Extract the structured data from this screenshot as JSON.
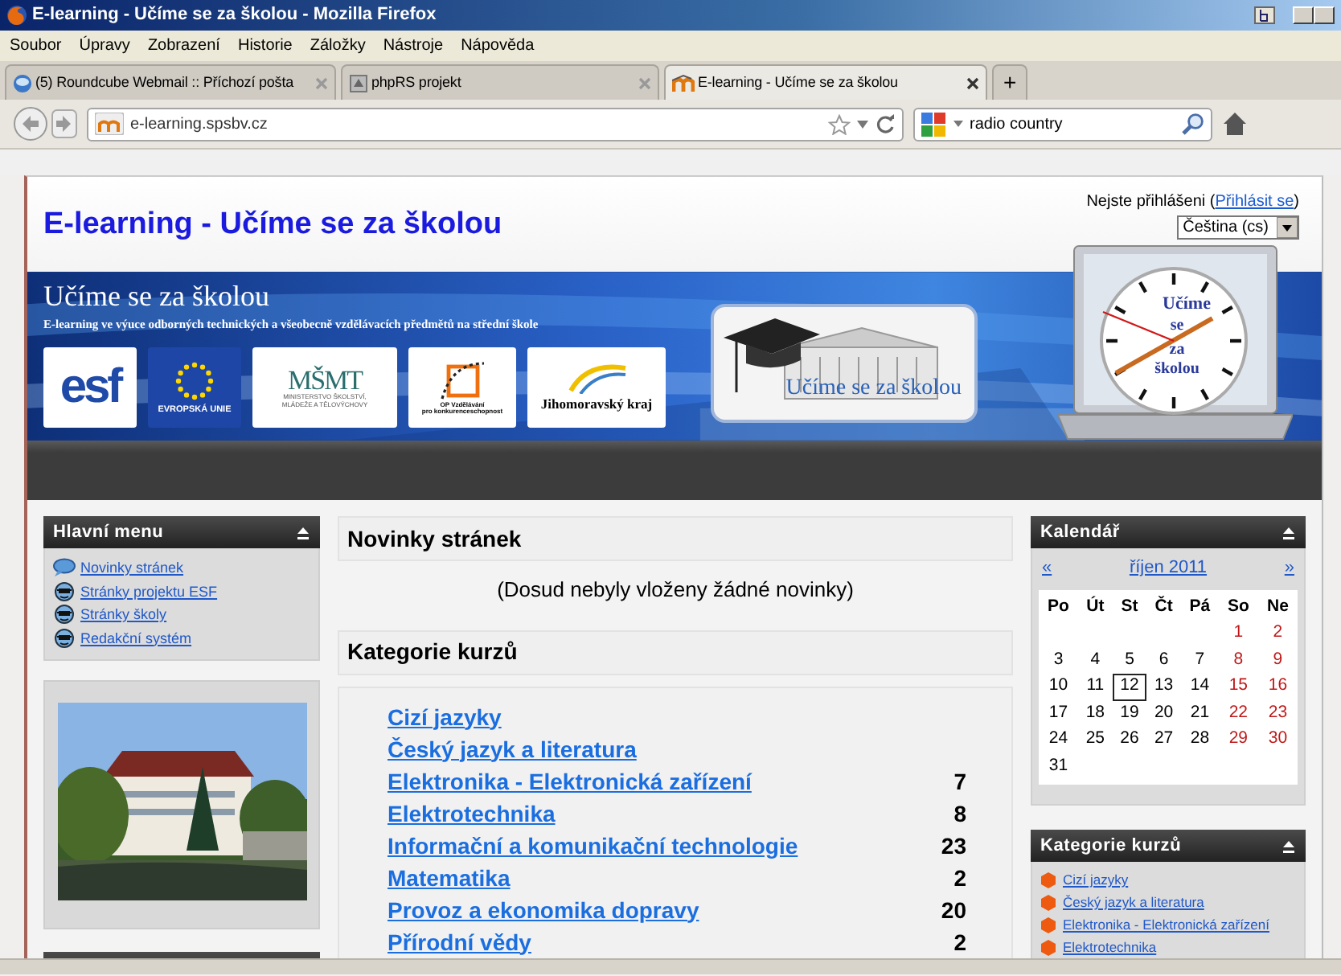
{
  "browser": {
    "title": "E-learning - Učíme se za školou - Mozilla Firefox",
    "menu": [
      "Soubor",
      "Úpravy",
      "Zobrazení",
      "Historie",
      "Záložky",
      "Nástroje",
      "Nápověda"
    ],
    "tabs": [
      {
        "label": "(5) Roundcube Webmail :: Příchozí pošta",
        "kind": "mail",
        "selected": false
      },
      {
        "label": "phpRS projekt",
        "kind": "php",
        "selected": false
      },
      {
        "label": "E-learning - Učíme se za školou",
        "kind": "moodle",
        "selected": true
      }
    ],
    "new_tab": "+",
    "address": "e-learning.spsbv.cz",
    "search": "radio country"
  },
  "header": {
    "title": "E-learning - Učíme se za školou",
    "login_prefix": "Nejste přihlášeni (",
    "login_link": "Přihlásit se",
    "login_suffix": ")",
    "language": "Čeština (cs)"
  },
  "banner": {
    "title": "Učíme se za školou",
    "subtitle": "E-learning ve výuce odborných technických a všeobecně vzdělávacích předmětů na střední škole",
    "logos": [
      {
        "kind": "esf",
        "texts": [
          "esf"
        ]
      },
      {
        "kind": "eu",
        "texts": [
          "EVROPSKÁ UNIE"
        ]
      },
      {
        "kind": "msmt",
        "texts": [
          "MŠMT",
          "MINISTERSTVO ŠKOLSTVÍ,",
          "MLÁDEŽE A TĚLOVÝCHOVY"
        ]
      },
      {
        "kind": "op",
        "texts": [
          "OP Vzdělávání",
          "pro konkurenceschopnost"
        ]
      },
      {
        "kind": "jmk",
        "texts": [
          "Jihomoravský kraj"
        ]
      }
    ],
    "emblem": "Učíme se za školou",
    "clock_words": [
      "Učíme",
      "se",
      "za",
      "školou"
    ]
  },
  "main_menu": {
    "title": "Hlavní menu",
    "items": [
      {
        "label": "Novinky stránek",
        "kind": "news"
      },
      {
        "label": "Stránky projektu ESF",
        "kind": "page"
      },
      {
        "label": "Stránky školy",
        "kind": "page"
      },
      {
        "label": "Redakční systém",
        "kind": "page"
      }
    ]
  },
  "news": {
    "title": "Novinky stránek",
    "empty_text": "(Dosud nebyly vloženy žádné novinky)"
  },
  "categories": {
    "title": "Kategorie kurzů",
    "items": [
      {
        "name": "Cizí jazyky"
      },
      {
        "name": "Český jazyk a literatura"
      },
      {
        "name": "Elektronika - Elektronická zařízení",
        "count": "7"
      },
      {
        "name": "Elektrotechnika",
        "count": "8"
      },
      {
        "name": "Informační a komunikační technologie",
        "count": "23"
      },
      {
        "name": "Matematika",
        "count": "2"
      },
      {
        "name": "Provoz a ekonomika dopravy",
        "count": "20"
      },
      {
        "name": "Přírodní vědy",
        "count": "2"
      }
    ]
  },
  "calendar": {
    "title": "Kalendář",
    "prev": "«",
    "month": "říjen 2011",
    "next": "»",
    "weekdays": [
      "Po",
      "Út",
      "St",
      "Čt",
      "Pá",
      "So",
      "Ne"
    ],
    "weeks": [
      [
        {
          "day": "1",
          "weekend": true,
          "today": false
        },
        {
          "day": "2",
          "weekend": true,
          "today": false
        }
      ],
      [
        {
          "day": "3",
          "weekend": false,
          "today": false
        },
        {
          "day": "4",
          "weekend": false,
          "today": false
        },
        {
          "day": "5",
          "weekend": false,
          "today": false
        },
        {
          "day": "6",
          "weekend": false,
          "today": false
        },
        {
          "day": "7",
          "weekend": false,
          "today": false
        },
        {
          "day": "8",
          "weekend": true,
          "today": false
        },
        {
          "day": "9",
          "weekend": true,
          "today": false
        }
      ],
      [
        {
          "day": "10",
          "weekend": false,
          "today": false
        },
        {
          "day": "11",
          "weekend": false,
          "today": false
        },
        {
          "day": "12",
          "weekend": false,
          "today": true
        },
        {
          "day": "13",
          "weekend": false,
          "today": false
        },
        {
          "day": "14",
          "weekend": false,
          "today": false
        },
        {
          "day": "15",
          "weekend": true,
          "today": false
        },
        {
          "day": "16",
          "weekend": true,
          "today": false
        }
      ],
      [
        {
          "day": "17",
          "weekend": false,
          "today": false
        },
        {
          "day": "18",
          "weekend": false,
          "today": false
        },
        {
          "day": "19",
          "weekend": false,
          "today": false
        },
        {
          "day": "20",
          "weekend": false,
          "today": false
        },
        {
          "day": "21",
          "weekend": false,
          "today": false
        },
        {
          "day": "22",
          "weekend": true,
          "today": false
        },
        {
          "day": "23",
          "weekend": true,
          "today": false
        }
      ],
      [
        {
          "day": "24",
          "weekend": false,
          "today": false
        },
        {
          "day": "25",
          "weekend": false,
          "today": false
        },
        {
          "day": "26",
          "weekend": false,
          "today": false
        },
        {
          "day": "27",
          "weekend": false,
          "today": false
        },
        {
          "day": "28",
          "weekend": false,
          "today": false
        },
        {
          "day": "29",
          "weekend": true,
          "today": false
        },
        {
          "day": "30",
          "weekend": true,
          "today": false
        }
      ],
      [
        {
          "day": "31",
          "weekend": false,
          "today": false
        }
      ]
    ]
  },
  "side_categories": {
    "title": "Kategorie kurzů",
    "items": [
      "Cizí jazyky",
      "Český jazyk a literatura",
      "Elektronika - Elektronická zařízení",
      "Elektrotechnika"
    ]
  }
}
